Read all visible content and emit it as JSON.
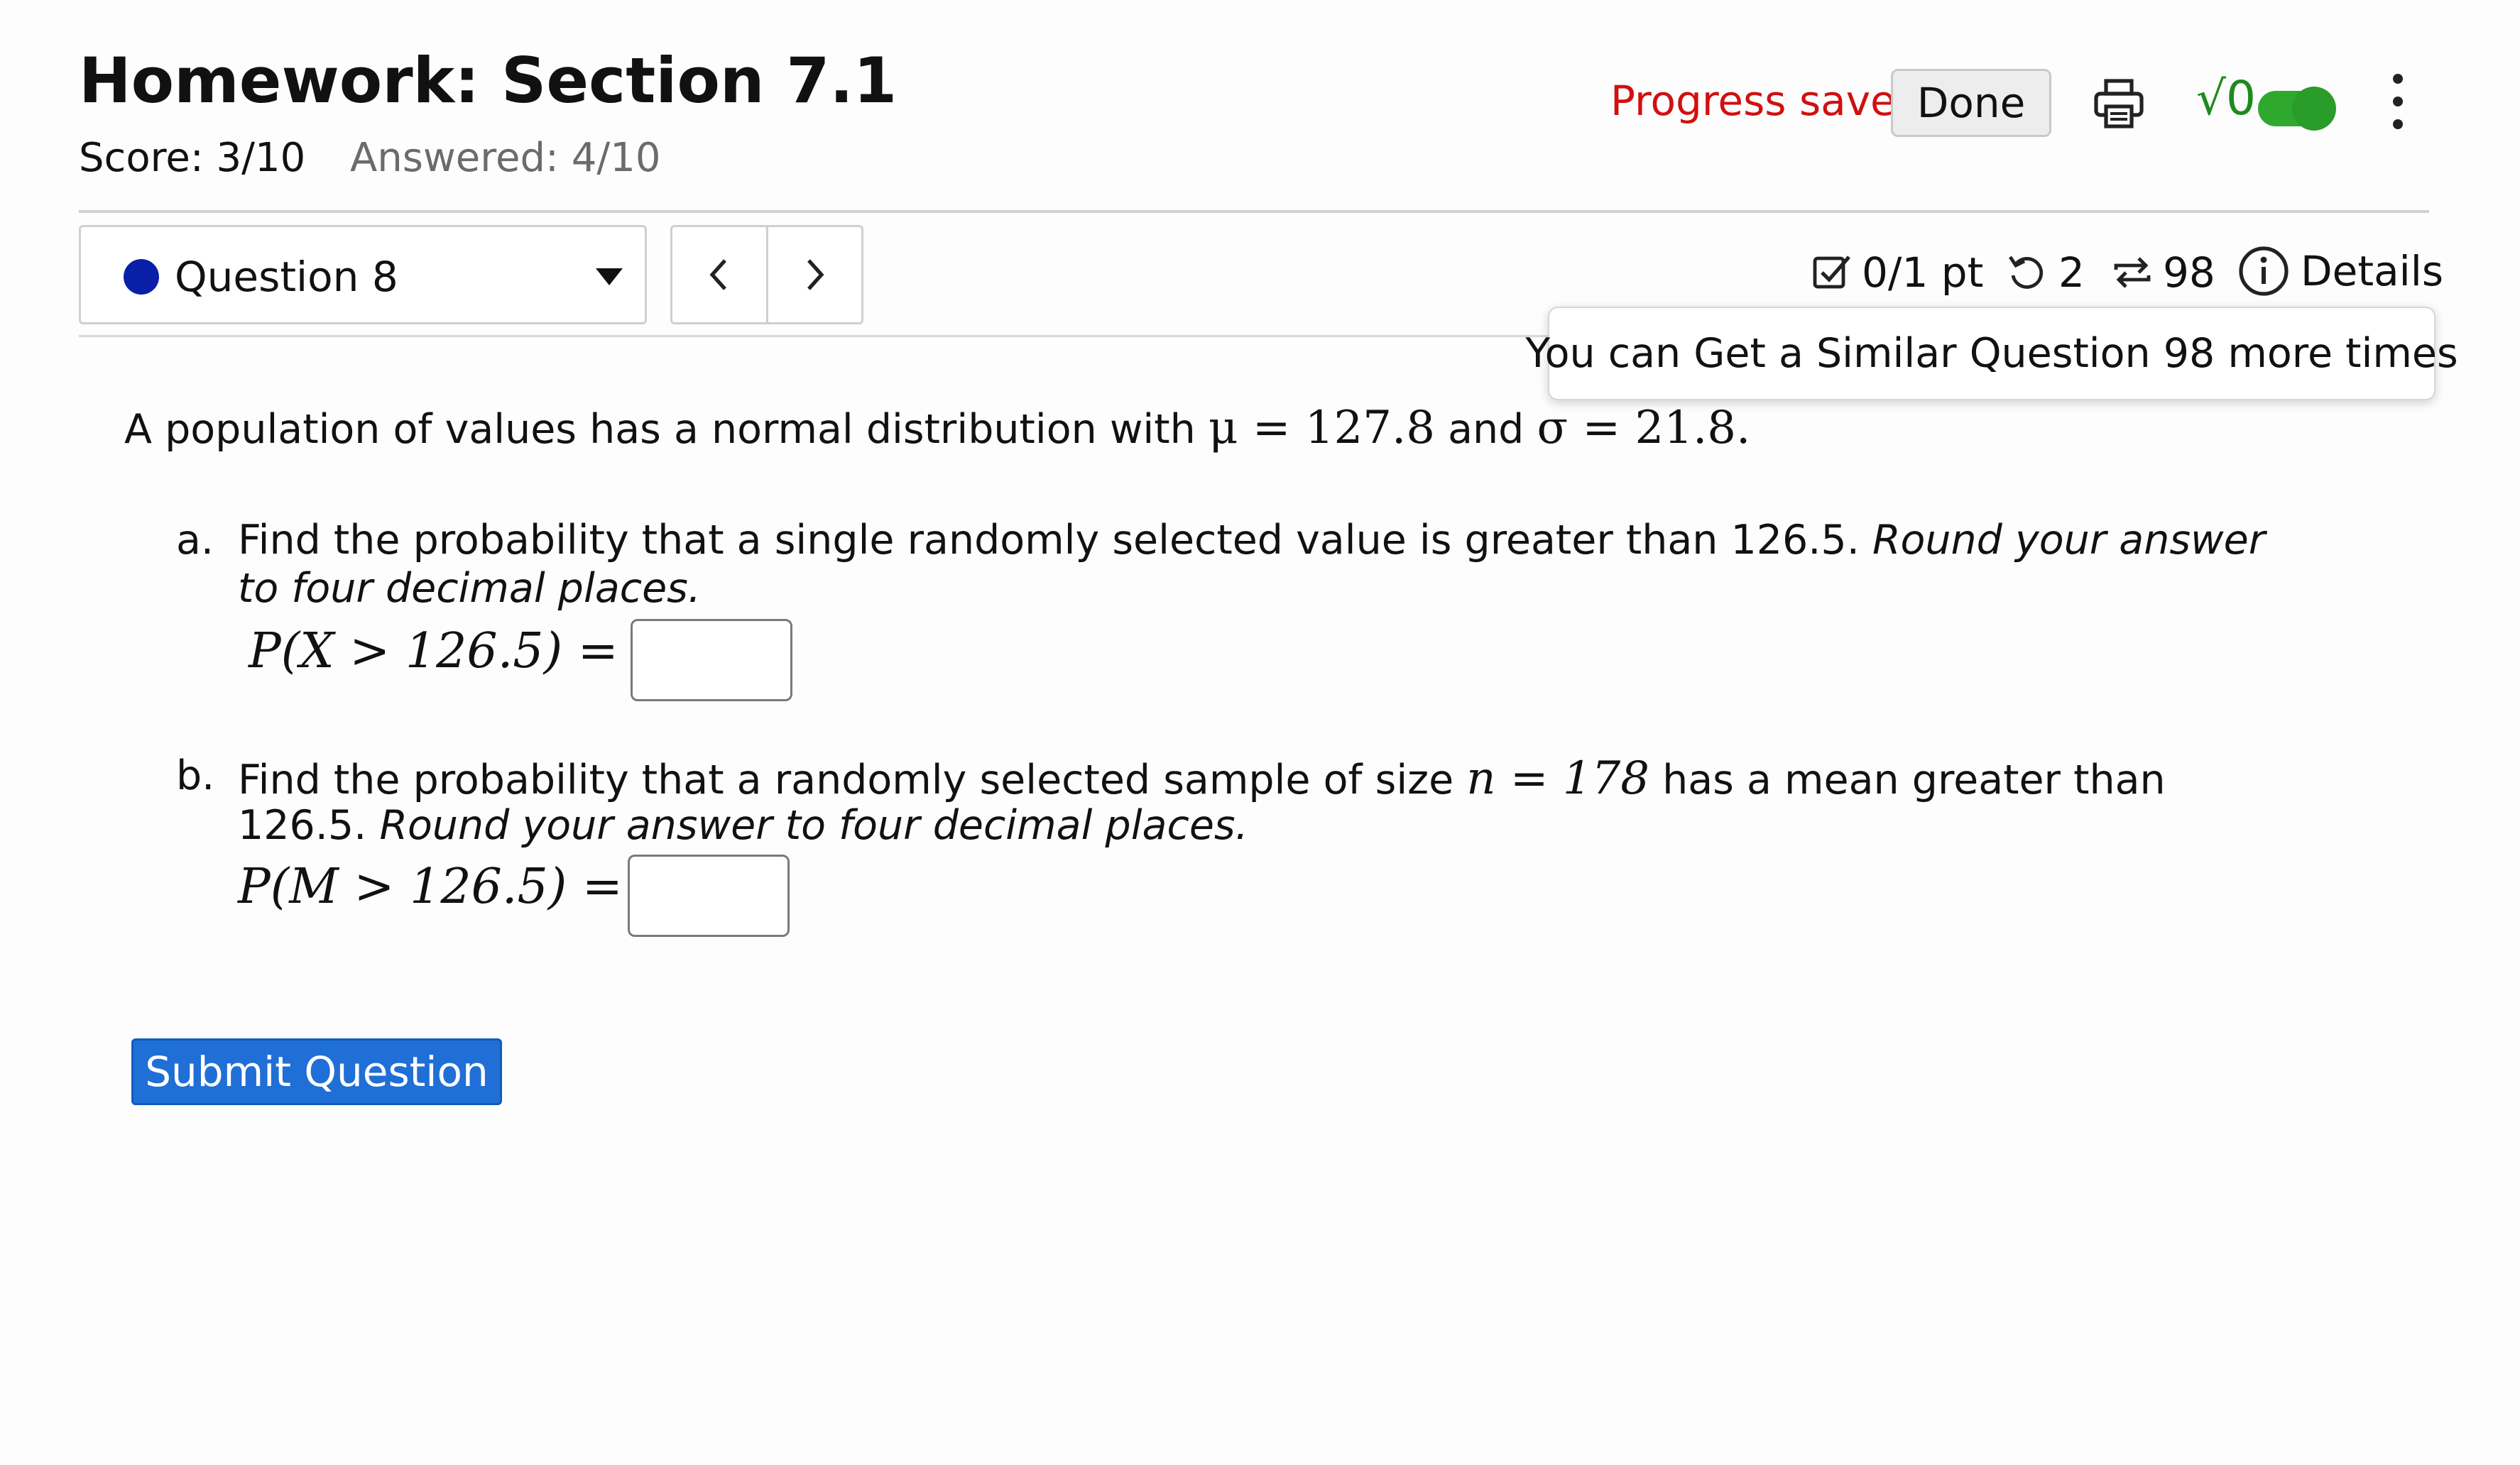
{
  "header": {
    "title": "Homework: Section 7.1",
    "score": "Score: 3/10",
    "answered": "Answered: 4/10",
    "progress_status": "Progress saved",
    "done_label": "Done",
    "sqrt_label": "√0",
    "math_toggle_on": true,
    "status_color": "#d10f0f",
    "toggle_color": "#2fa82f"
  },
  "question_nav": {
    "current_question": "Question 8",
    "prev_icon": "chevron-left-icon",
    "next_icon": "chevron-right-icon"
  },
  "question_meta": {
    "points": "0/1 pt",
    "retries": "2",
    "similar_remaining": "98",
    "details_label": "Details"
  },
  "tooltip": {
    "text": "You can Get a Similar Question 98 more times"
  },
  "problem": {
    "intro_text": "A population of values has a normal distribution with",
    "mu": "μ = 127.8",
    "and": "and",
    "sigma": "σ = 21.8.",
    "parts": [
      {
        "letter": "a.",
        "text": "Find the probability that a single randomly selected value is greater than 126.5.",
        "instruction_line1": "Round your answer",
        "instruction_line2": "to four decimal places.",
        "math_label": "P(X > 126.5) =",
        "answer_value": ""
      },
      {
        "letter": "b.",
        "text_before": "Find the probability that a randomly selected sample of size",
        "n_expr": "n = 178",
        "text_after": "has a mean greater than",
        "continuation": "126.5.",
        "instruction": "Round your answer to four decimal places.",
        "math_label": "P(M > 126.5) =",
        "answer_value": ""
      }
    ]
  },
  "actions": {
    "submit_label": "Submit Question",
    "submit_color": "#1f6fd6"
  }
}
